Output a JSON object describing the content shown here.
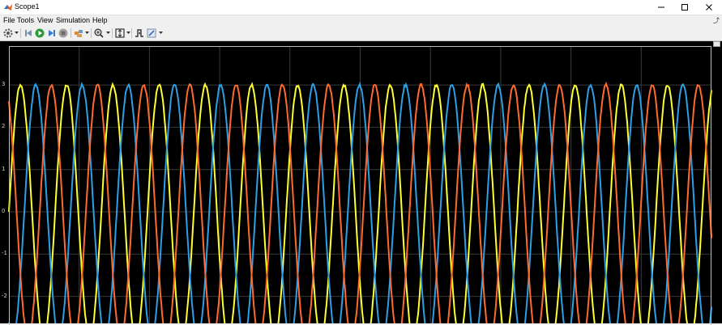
{
  "window": {
    "title": "Scope1",
    "controls": [
      "minimize-icon",
      "maximize-icon",
      "close-icon"
    ]
  },
  "menu": {
    "items": [
      "File",
      "Tools",
      "View",
      "Simulation",
      "Help"
    ]
  },
  "toolbar": {
    "icons": [
      "settings-icon",
      "step-back-icon",
      "run-icon",
      "step-forward-icon",
      "stop-icon",
      "highlight-icon",
      "zoom-icon",
      "fit-axes-icon",
      "triggers-icon",
      "edit-style-icon"
    ]
  },
  "chart_data": {
    "type": "line",
    "title": "",
    "xlabel": "",
    "ylabel": "",
    "ylim": [
      -2.6,
      3.3
    ],
    "yticks": [
      "3",
      "2",
      "1",
      "0",
      "-1",
      "-2"
    ],
    "xgrid_lines": 10,
    "grid": true,
    "background": "#000000",
    "grid_color": "#3a3a3a",
    "amplitude": 3,
    "cycles_visible": 15.2,
    "series": [
      {
        "color": "#ffff33",
        "phase_deg": 0
      },
      {
        "color": "#2e9ee6",
        "phase_deg": -120
      },
      {
        "color": "#ff6a2e",
        "phase_deg": 120
      }
    ]
  }
}
